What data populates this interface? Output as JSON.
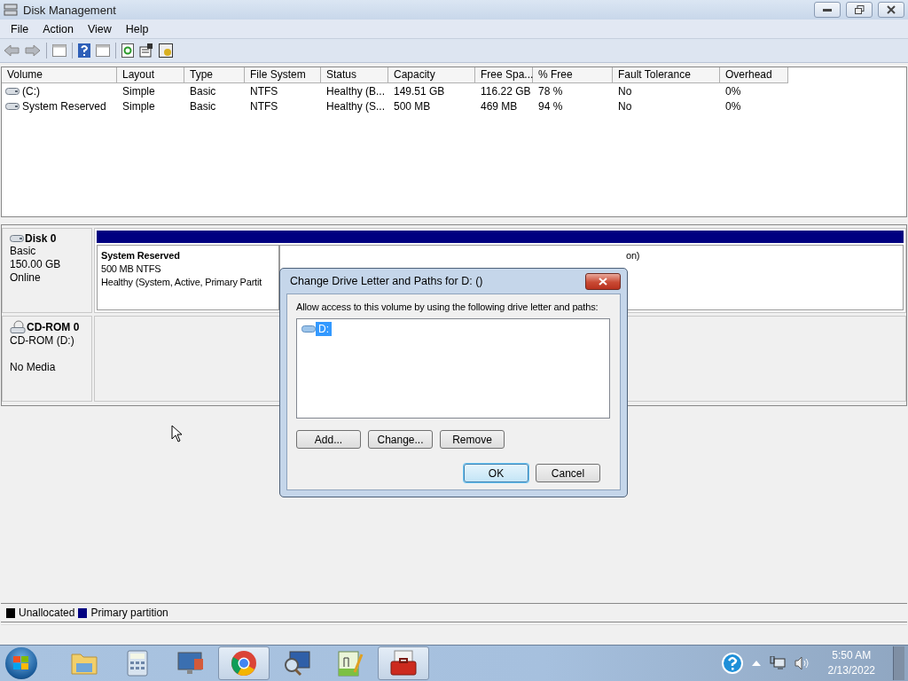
{
  "window": {
    "title": "Disk Management"
  },
  "menu": [
    "File",
    "Action",
    "View",
    "Help"
  ],
  "volume_table": {
    "columns": [
      "Volume",
      "Layout",
      "Type",
      "File System",
      "Status",
      "Capacity",
      "Free Spa...",
      "% Free",
      "Fault Tolerance",
      "Overhead"
    ],
    "rows": [
      [
        "(C:)",
        "Simple",
        "Basic",
        "NTFS",
        "Healthy (B...",
        "149.51 GB",
        "116.22 GB",
        "78 %",
        "No",
        "0%"
      ],
      [
        "System Reserved",
        "Simple",
        "Basic",
        "NTFS",
        "Healthy (S...",
        "500 MB",
        "469 MB",
        "94 %",
        "No",
        "0%"
      ]
    ]
  },
  "disks": [
    {
      "kind": "disk",
      "name": "Disk 0",
      "lines": [
        "Basic",
        "150.00 GB",
        "Online"
      ],
      "partitions": [
        {
          "color": "#000080",
          "lines": [
            "System Reserved",
            "500 MB NTFS",
            "Healthy (System, Active, Primary Partit"
          ]
        },
        {
          "color": "#000080",
          "lines": [
            "on)"
          ]
        }
      ]
    },
    {
      "kind": "cdrom",
      "name": "CD-ROM 0",
      "lines": [
        "CD-ROM (D:)",
        "No Media"
      ]
    }
  ],
  "legend": [
    {
      "label": "Unallocated",
      "color": "#000000"
    },
    {
      "label": "Primary partition",
      "color": "#000080"
    }
  ],
  "dialog": {
    "title": "Change Drive Letter and Paths for D: ()",
    "prompt": "Allow access to this volume by using the following drive letter and paths:",
    "entries": [
      {
        "label": "D:",
        "selected": true
      }
    ],
    "actions": [
      {
        "label": "Add...",
        "default": false
      },
      {
        "label": "Change...",
        "default": false
      },
      {
        "label": "Remove",
        "default": false
      }
    ],
    "buttons": [
      {
        "label": "OK",
        "default": true
      },
      {
        "label": "Cancel",
        "default": false
      }
    ]
  },
  "taskbar": {
    "apps": [
      {
        "kind": "folder",
        "active": false
      },
      {
        "kind": "calculator",
        "active": false
      },
      {
        "kind": "monitor",
        "active": false
      },
      {
        "kind": "browser",
        "active": true
      },
      {
        "kind": "magnifier",
        "active": false
      },
      {
        "kind": "notepad",
        "active": false
      },
      {
        "kind": "toolbox",
        "active": true
      }
    ],
    "time": "5:50 AM",
    "date": "2/13/2022"
  }
}
